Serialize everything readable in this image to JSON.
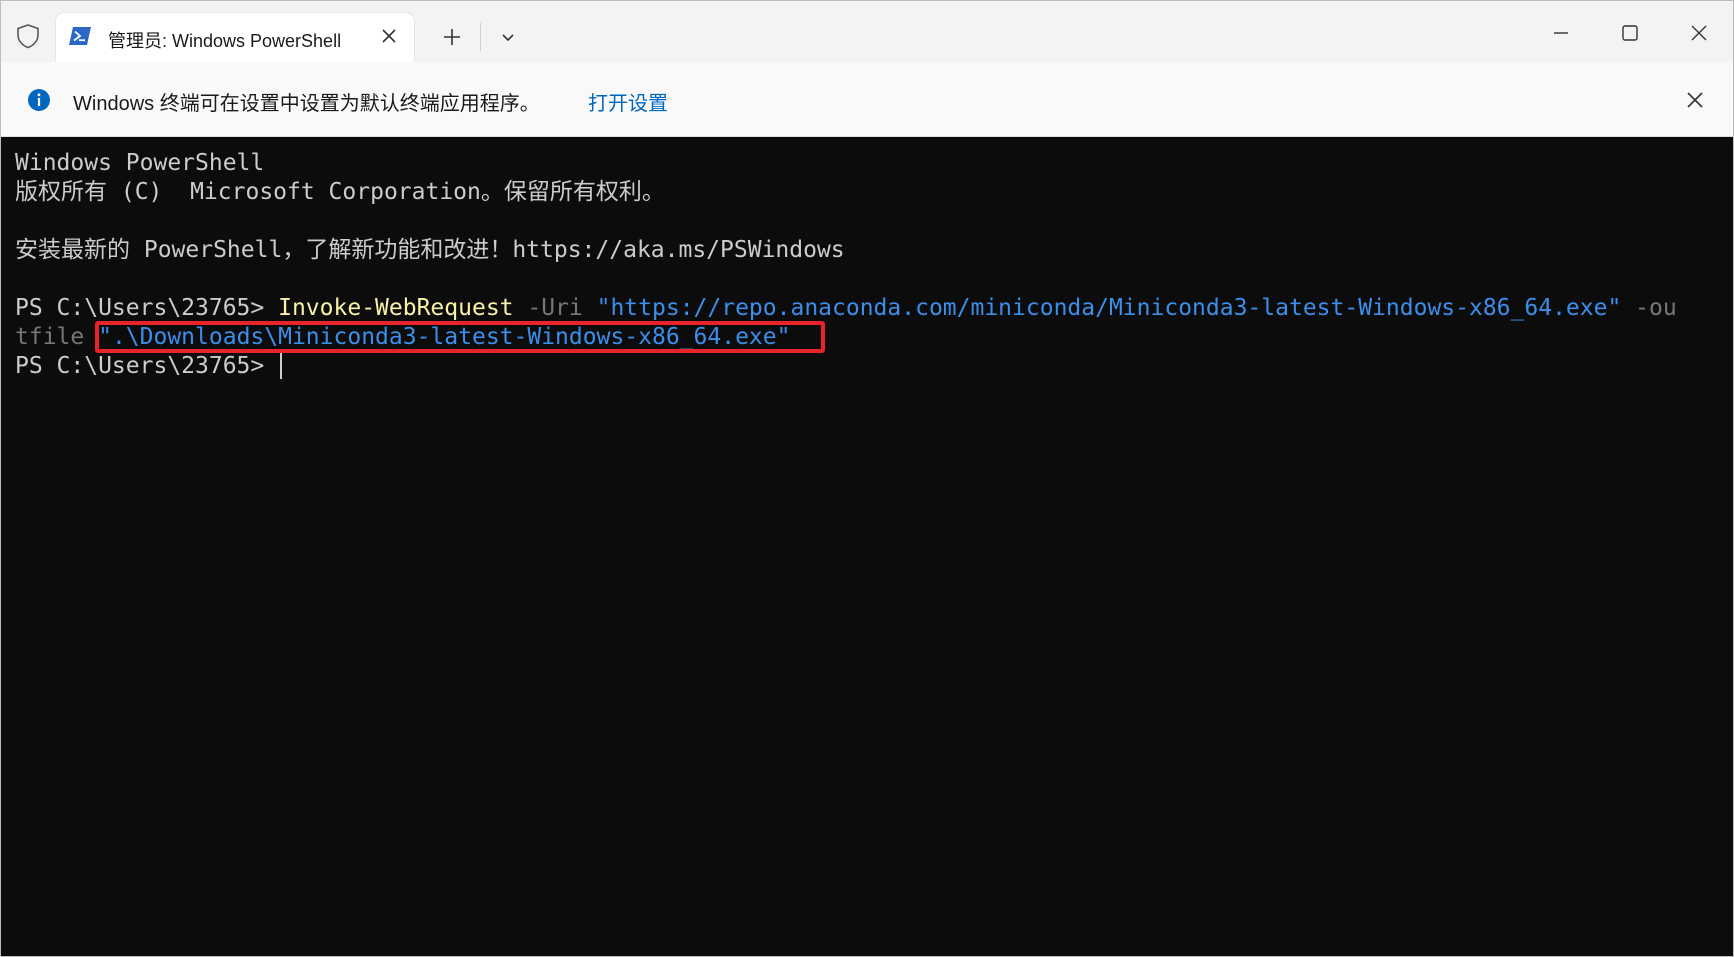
{
  "titlebar": {
    "tab_title": "管理员: Windows PowerShell",
    "icons": [
      "shield-icon",
      "powershell-icon",
      "close-icon",
      "plus-icon",
      "chevron-down-icon",
      "minimize-icon",
      "maximize-icon",
      "close-window-icon"
    ]
  },
  "infobar": {
    "message": "Windows 终端可在设置中设置为默认终端应用程序。",
    "link": "打开设置",
    "icons": [
      "info-icon",
      "close-icon"
    ]
  },
  "terminal": {
    "line1": "Windows PowerShell",
    "line2": "版权所有 (C)  Microsoft Corporation。保留所有权利。",
    "line4": "安装最新的 PowerShell，了解新功能和改进！https://aka.ms/PSWindows",
    "prompt": "PS C:\\Users\\23765> ",
    "cmd": "Invoke-WebRequest",
    "param1": " -Uri ",
    "url": "\"https://repo.anaconda.com/miniconda/Miniconda3-latest-Windows-x86_64.exe\"",
    "param2_part1": " -ou",
    "param2_part2": "tfile ",
    "outfile": "\".\\Downloads\\Miniconda3-latest-Windows-x86_64.exe\"",
    "prompt2": "PS C:\\Users\\23765> "
  },
  "colors": {
    "terminal_bg": "#0c0c0c",
    "terminal_fg": "#cccccc",
    "command": "#f9f1a5",
    "parameter": "#767676",
    "string": "#3b8eea",
    "highlight_border": "#e8232a",
    "link": "#0067c0",
    "info_icon": "#0067c0"
  }
}
